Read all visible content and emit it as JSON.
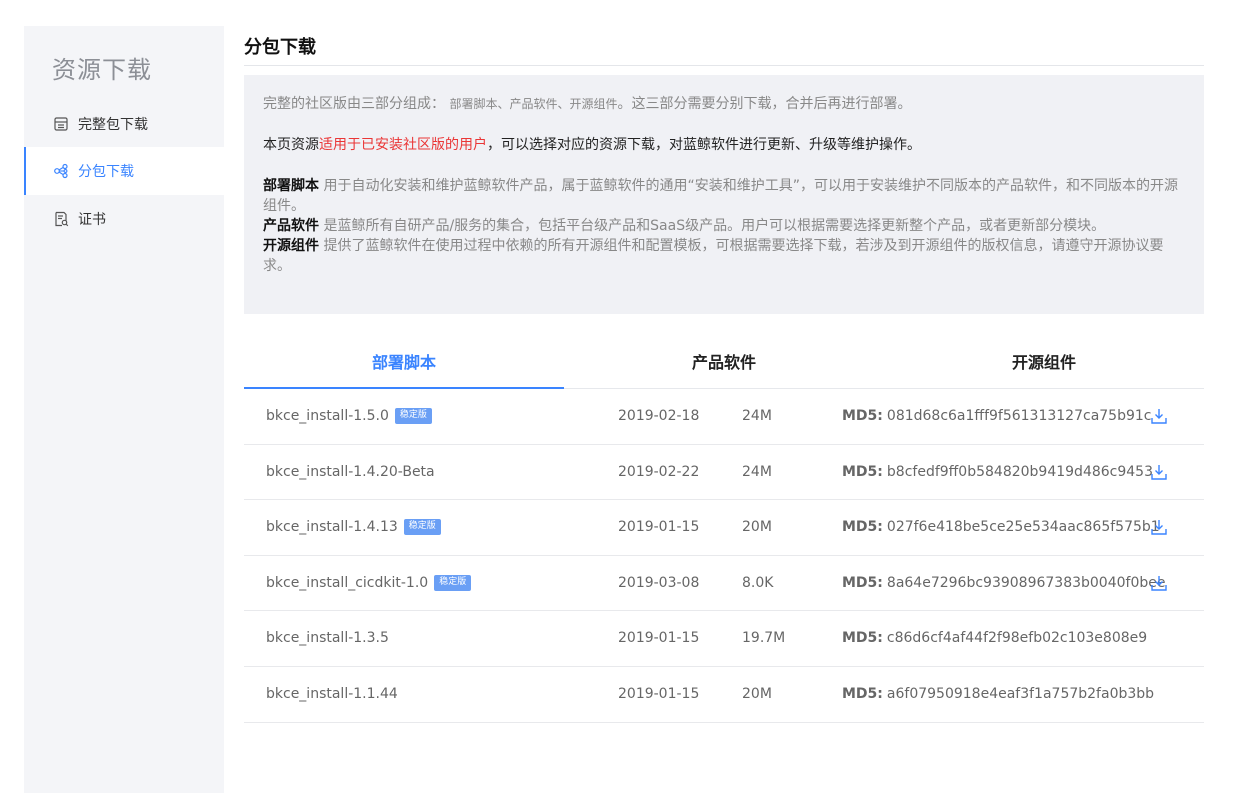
{
  "sidebar": {
    "title": "资源下载",
    "items": [
      {
        "label": "完整包下载",
        "icon": "package-icon",
        "active": false
      },
      {
        "label": "分包下载",
        "icon": "share-nodes-icon",
        "active": true
      },
      {
        "label": "证书",
        "icon": "certificate-icon",
        "active": false
      }
    ]
  },
  "page": {
    "title": "分包下载"
  },
  "info": {
    "intro_prefix": "完整的社区版由三部分组成：",
    "intro_parts": "部署脚本、产品软件、开源组件",
    "intro_suffix": "。这三部分需要分别下载，合并后再进行部署。",
    "scope_prefix": "本页资源",
    "scope_highlight": "适用于已安装社区版的用户",
    "scope_suffix": "，可以选择对应的资源下载，对蓝鲸软件进行更新、升级等维护操作。",
    "deploy_label": "部署脚本",
    "deploy_text": "用于自动化安装和维护蓝鲸软件产品，属于蓝鲸软件的通用“安装和维护工具”，可以用于安装维护不同版本的产品软件，和不同版本的开源组件。",
    "product_label": "产品软件",
    "product_text": "是蓝鲸所有自研产品/服务的集合，包括平台级产品和SaaS级产品。用户可以根据需要选择更新整个产品，或者更新部分模块。",
    "oss_label": "开源组件",
    "oss_text": "提供了蓝鲸软件在使用过程中依赖的所有开源组件和配置模板，可根据需要选择下载，若涉及到开源组件的版权信息，请遵守开源协议要求。"
  },
  "tabs": [
    {
      "label": "部署脚本",
      "active": true
    },
    {
      "label": "产品软件",
      "active": false
    },
    {
      "label": "开源组件",
      "active": false
    }
  ],
  "md5_label": "MD5:",
  "rows": [
    {
      "name": "bkce_install-1.5.0",
      "badge": "稳定版",
      "date": "2019-02-18",
      "size": "24M",
      "md5": "081d68c6a1fff9f561313127ca75b91c",
      "download": true
    },
    {
      "name": "bkce_install-1.4.20-Beta",
      "badge": "",
      "date": "2019-02-22",
      "size": "24M",
      "md5": "b8cfedf9ff0b584820b9419d486c9453",
      "download": true
    },
    {
      "name": "bkce_install-1.4.13",
      "badge": "稳定版",
      "date": "2019-01-15",
      "size": "20M",
      "md5": "027f6e418be5ce25e534aac865f575b1",
      "download": true
    },
    {
      "name": "bkce_install_cicdkit-1.0",
      "badge": "稳定版",
      "date": "2019-03-08",
      "size": "8.0K",
      "md5": "8a64e7296bc93908967383b0040f0bee",
      "download": true
    },
    {
      "name": "bkce_install-1.3.5",
      "badge": "",
      "date": "2019-01-15",
      "size": "19.7M",
      "md5": "c86d6cf4af44f2f98efb02c103e808e9",
      "download": false
    },
    {
      "name": "bkce_install-1.1.44",
      "badge": "",
      "date": "2019-01-15",
      "size": "20M",
      "md5": "a6f07950918e4eaf3f1a757b2fa0b3bb",
      "download": false
    }
  ],
  "colors": {
    "accent": "#3a84ff",
    "highlight_red": "#ea3636",
    "badge": "#6a9ff5",
    "sidebar_bg": "#f4f5f8",
    "info_bg": "#f0f1f5"
  }
}
